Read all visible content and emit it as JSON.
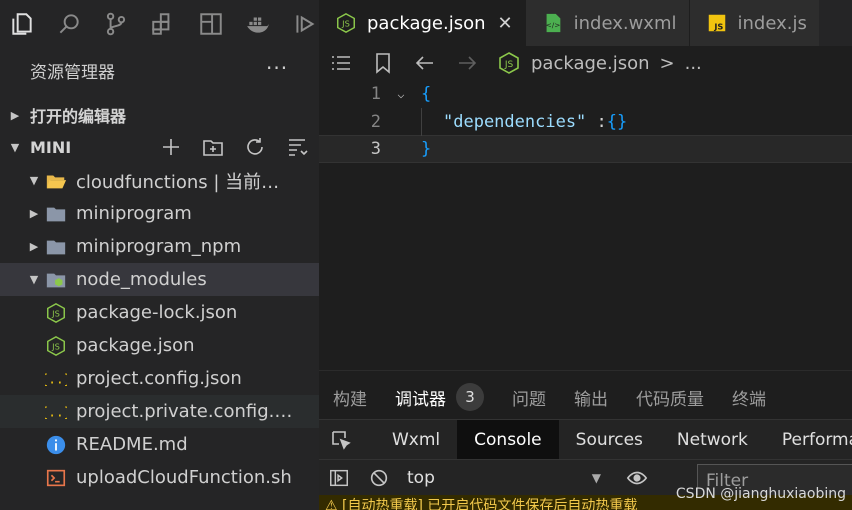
{
  "activity_bar": {
    "icons": [
      "explorer-icon",
      "search-icon",
      "source-control-icon",
      "extensions-icon",
      "layout-icon",
      "docker-icon",
      "debug-icon"
    ]
  },
  "sidebar": {
    "title": "资源管理器",
    "more": "···",
    "open_editors_label": "打开的编辑器",
    "workspace_label": "MINI",
    "tree": [
      {
        "label": "cloudfunctions | 当前环...",
        "icon": "folder-open-icon",
        "twisty": "▼"
      },
      {
        "label": "miniprogram",
        "icon": "folder-icon",
        "twisty": "▶"
      },
      {
        "label": "miniprogram_npm",
        "icon": "folder-icon",
        "twisty": "▶"
      },
      {
        "label": "node_modules",
        "icon": "folder-node-icon",
        "twisty": "▼"
      },
      {
        "label": "package-lock.json",
        "icon": "nodejs-file-icon",
        "twisty": ""
      },
      {
        "label": "package.json",
        "icon": "nodejs-file-icon",
        "twisty": ""
      },
      {
        "label": "project.config.json",
        "icon": "json-file-icon",
        "twisty": ""
      },
      {
        "label": "project.private.config.json",
        "icon": "json-file-icon",
        "twisty": ""
      },
      {
        "label": "README.md",
        "icon": "info-file-icon",
        "twisty": ""
      },
      {
        "label": "uploadCloudFunction.sh",
        "icon": "shell-file-icon",
        "twisty": ""
      }
    ]
  },
  "tabs": [
    {
      "label": "package.json",
      "close": "✕"
    },
    {
      "label": "index.wxml"
    },
    {
      "label": "index.js"
    }
  ],
  "breadcrumb": {
    "file": "package.json",
    "separator": ">",
    "ellipsis": "..."
  },
  "editor": {
    "lines": [
      {
        "number": "1",
        "open_brace": "{"
      },
      {
        "number": "2",
        "key": "\"dependencies\"",
        "colon": " :",
        "value": "{}"
      },
      {
        "number": "3",
        "close_brace": "}"
      }
    ]
  },
  "panel": {
    "tabs": [
      "构建",
      "调试器",
      "问题",
      "输出",
      "代码质量",
      "终端"
    ],
    "debugger_badge": "3",
    "devtools_tabs": [
      "Wxml",
      "Console",
      "Sources",
      "Network",
      "Performa"
    ],
    "context": "top",
    "filter_placeholder": "Filter",
    "warning_text": "⚠ [自动热重载] 已开启代码文件保存后自动热重载"
  },
  "watermark": "CSDN @jianghuxiaobing",
  "colors": {
    "accent": "#179fff",
    "node_green": "#8cc84b",
    "json_yellow": "#f1c40f",
    "folder": "#8b96a8",
    "shell": "#e8764b"
  }
}
